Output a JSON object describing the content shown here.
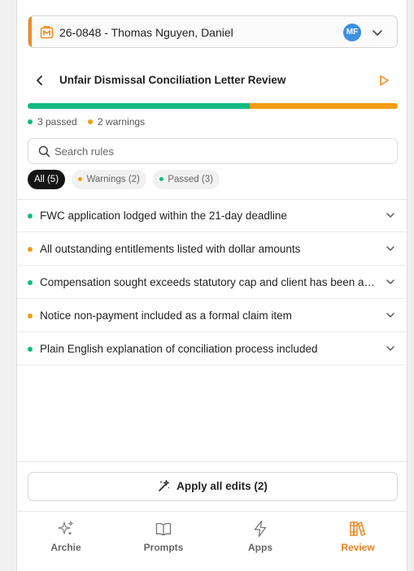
{
  "matter": {
    "title": "26-0848 - Thomas Nguyen, Daniel",
    "avatar_initials": "MF",
    "accent_color": "#f28a1f",
    "avatar_color": "#3d8fe0",
    "icon": "matter-briefcase-icon"
  },
  "review": {
    "title": "Unfair Dismissal Conciliation Letter Review",
    "passed_fraction": 0.6,
    "summary_passed": "3 passed",
    "summary_warnings": "2 warnings"
  },
  "search": {
    "placeholder": "Search rules",
    "value": ""
  },
  "filters": [
    {
      "label": "All (5)",
      "active": true
    },
    {
      "label": "Warnings (2)",
      "active": false
    },
    {
      "label": "Passed (3)",
      "active": false
    }
  ],
  "rules": [
    {
      "text": "FWC application lodged within the 21-day deadline",
      "status": "passed"
    },
    {
      "text": "All outstanding entitlements listed with dollar amounts",
      "status": "warning"
    },
    {
      "text": "Compensation sought exceeds statutory cap and client has been advised",
      "status": "passed"
    },
    {
      "text": "Notice non-payment included as a formal claim item",
      "status": "warning"
    },
    {
      "text": "Plain English explanation of conciliation process included",
      "status": "passed"
    }
  ],
  "apply": {
    "label": "Apply all edits (2)"
  },
  "nav": [
    {
      "label": "Archie",
      "icon": "sparkle-icon",
      "active": false
    },
    {
      "label": "Prompts",
      "icon": "book-icon",
      "active": false
    },
    {
      "label": "Apps",
      "icon": "lightning-icon",
      "active": false
    },
    {
      "label": "Review",
      "icon": "books-icon",
      "active": true
    }
  ],
  "colors": {
    "passed": "#12b981",
    "warning": "#f39c12",
    "active_nav": "#e8821e"
  }
}
